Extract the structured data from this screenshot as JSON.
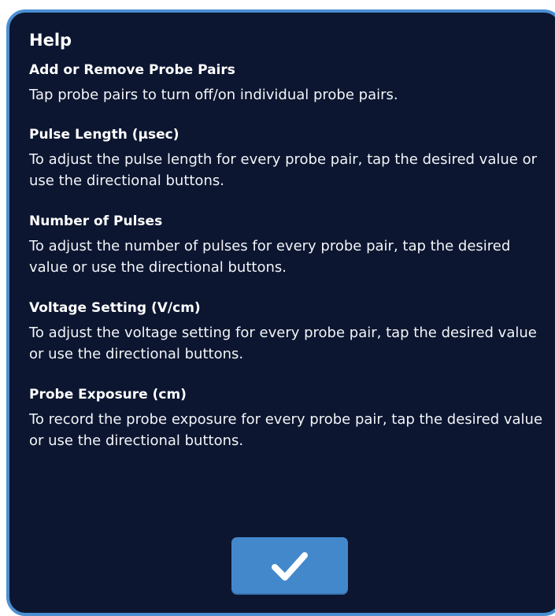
{
  "dialog": {
    "title": "Help",
    "sections": [
      {
        "heading": "Add or Remove Probe Pairs",
        "body": "Tap probe pairs to turn off/on individual probe pairs."
      },
      {
        "heading": "Pulse Length (µsec)",
        "body": "To adjust the pulse length for every probe pair, tap the desired value or use the directional buttons."
      },
      {
        "heading": "Number of Pulses",
        "body": "To adjust the number of pulses for every probe pair, tap the desired value or use the directional buttons."
      },
      {
        "heading": "Voltage Setting (V/cm)",
        "body": "To adjust the voltage setting for every probe pair, tap the desired value or use the directional buttons."
      },
      {
        "heading": "Probe Exposure (cm)",
        "body": "To record the probe exposure for every probe pair, tap the desired value or use the directional buttons."
      }
    ],
    "confirm_icon": "checkmark-icon"
  },
  "colors": {
    "dialog_background": "#0c1630",
    "dialog_border": "#4b8fd2",
    "button_background": "#4488cc",
    "text": "#ffffff"
  }
}
